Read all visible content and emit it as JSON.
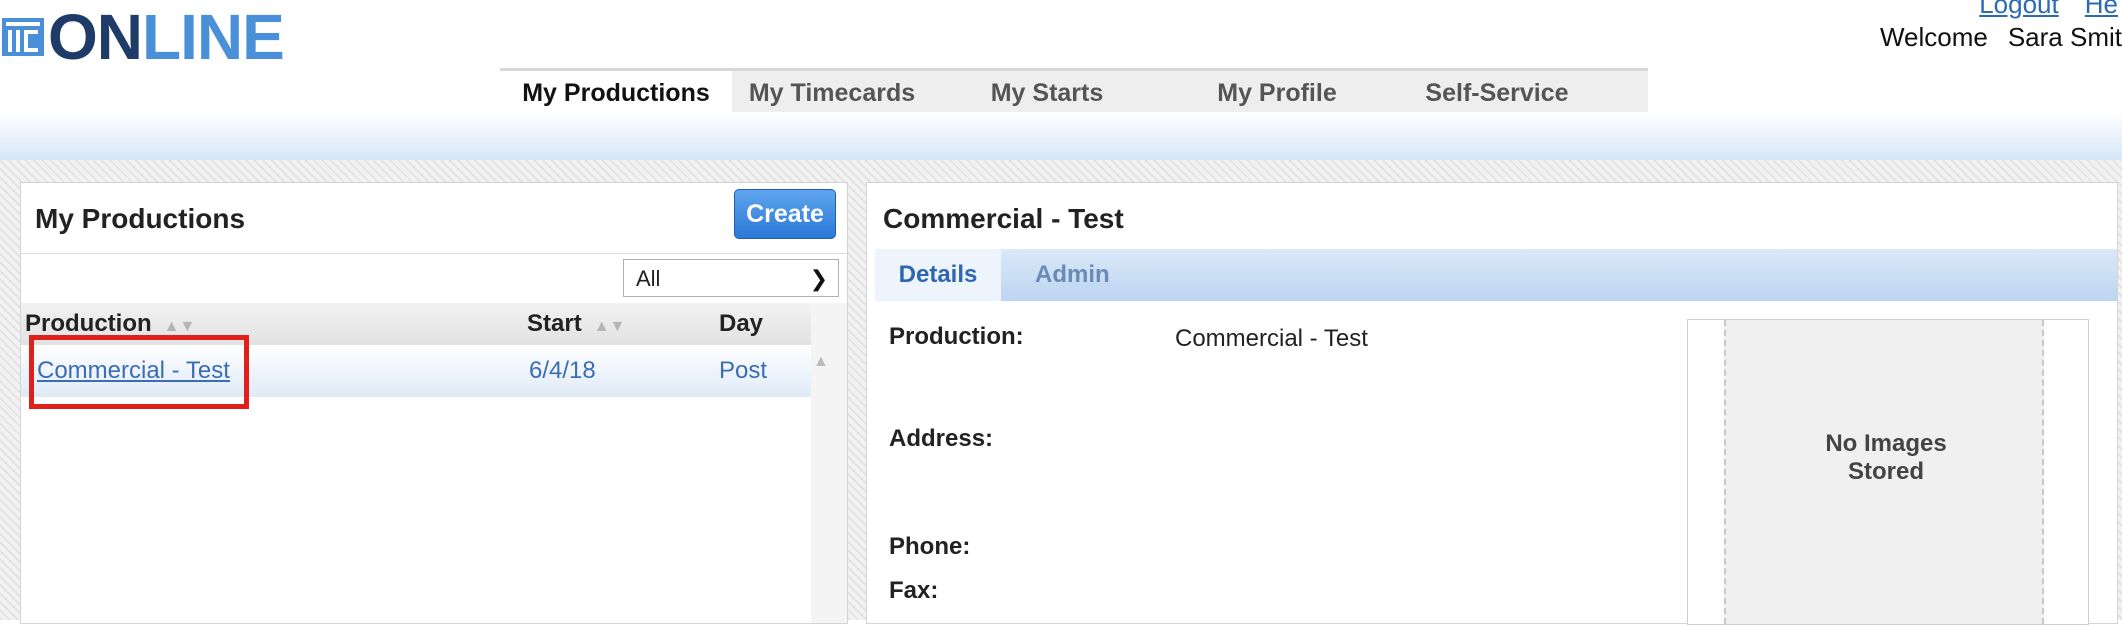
{
  "header": {
    "logo_text_o": "ON",
    "logo_text_rest": "LINE",
    "links": [
      "Logout",
      "He"
    ],
    "welcome_label": "Welcome",
    "user_name": "Sara Smit"
  },
  "nav": {
    "tabs": [
      "My Productions",
      "My Timecards",
      "My Starts",
      "My Profile",
      "Self-Service"
    ],
    "active_index": 0
  },
  "left_panel": {
    "title": "My Productions",
    "create_label": "Create",
    "filter_value": "All",
    "columns": [
      "Production",
      "Start",
      "Day"
    ],
    "rows": [
      {
        "production": "Commercial - Test",
        "start": "6/4/18",
        "day": "Post"
      }
    ]
  },
  "right_panel": {
    "title": "Commercial - Test",
    "tabs": [
      "Details",
      "Admin"
    ],
    "fields": {
      "production_label": "Production:",
      "production_value": "Commercial - Test",
      "address_label": "Address:",
      "phone_label": "Phone:",
      "fax_label": "Fax:"
    },
    "no_images_line1": "No Images",
    "no_images_line2": "Stored"
  },
  "colors": {
    "accent": "#2b78d6",
    "highlight": "#e0201b",
    "link": "#3a6db5"
  }
}
